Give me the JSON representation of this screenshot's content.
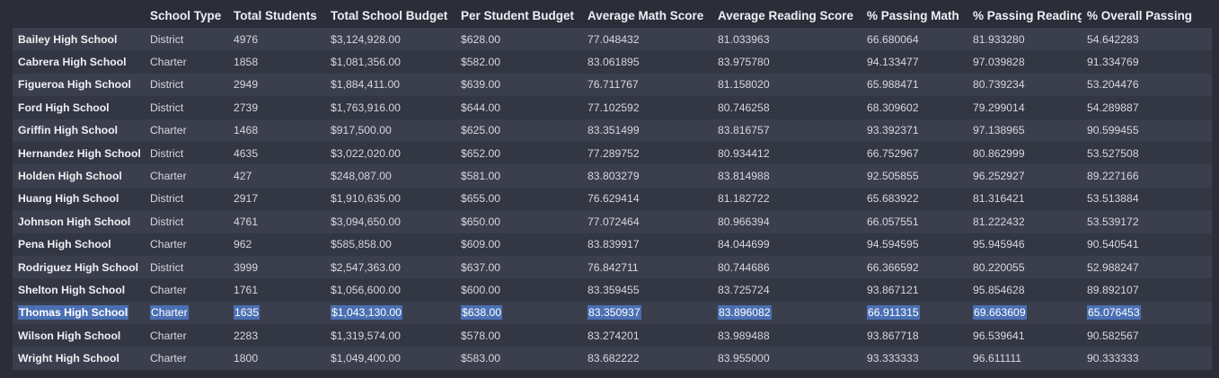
{
  "table": {
    "index_header": "",
    "columns": [
      "School Type",
      "Total Students",
      "Total School Budget",
      "Per Student Budget",
      "Average Math Score",
      "Average Reading Score",
      "% Passing Math",
      "% Passing Reading",
      "% Overall Passing"
    ],
    "rows": [
      {
        "name": "Bailey High School",
        "cells": [
          "District",
          "4976",
          "$3,124,928.00",
          "$628.00",
          "77.048432",
          "81.033963",
          "66.680064",
          "81.933280",
          "54.642283"
        ]
      },
      {
        "name": "Cabrera High School",
        "cells": [
          "Charter",
          "1858",
          "$1,081,356.00",
          "$582.00",
          "83.061895",
          "83.975780",
          "94.133477",
          "97.039828",
          "91.334769"
        ]
      },
      {
        "name": "Figueroa High School",
        "cells": [
          "District",
          "2949",
          "$1,884,411.00",
          "$639.00",
          "76.711767",
          "81.158020",
          "65.988471",
          "80.739234",
          "53.204476"
        ]
      },
      {
        "name": "Ford High School",
        "cells": [
          "District",
          "2739",
          "$1,763,916.00",
          "$644.00",
          "77.102592",
          "80.746258",
          "68.309602",
          "79.299014",
          "54.289887"
        ]
      },
      {
        "name": "Griffin High School",
        "cells": [
          "Charter",
          "1468",
          "$917,500.00",
          "$625.00",
          "83.351499",
          "83.816757",
          "93.392371",
          "97.138965",
          "90.599455"
        ]
      },
      {
        "name": "Hernandez High School",
        "cells": [
          "District",
          "4635",
          "$3,022,020.00",
          "$652.00",
          "77.289752",
          "80.934412",
          "66.752967",
          "80.862999",
          "53.527508"
        ]
      },
      {
        "name": "Holden High School",
        "cells": [
          "Charter",
          "427",
          "$248,087.00",
          "$581.00",
          "83.803279",
          "83.814988",
          "92.505855",
          "96.252927",
          "89.227166"
        ]
      },
      {
        "name": "Huang High School",
        "cells": [
          "District",
          "2917",
          "$1,910,635.00",
          "$655.00",
          "76.629414",
          "81.182722",
          "65.683922",
          "81.316421",
          "53.513884"
        ]
      },
      {
        "name": "Johnson High School",
        "cells": [
          "District",
          "4761",
          "$3,094,650.00",
          "$650.00",
          "77.072464",
          "80.966394",
          "66.057551",
          "81.222432",
          "53.539172"
        ]
      },
      {
        "name": "Pena High School",
        "cells": [
          "Charter",
          "962",
          "$585,858.00",
          "$609.00",
          "83.839917",
          "84.044699",
          "94.594595",
          "95.945946",
          "90.540541"
        ]
      },
      {
        "name": "Rodriguez High School",
        "cells": [
          "District",
          "3999",
          "$2,547,363.00",
          "$637.00",
          "76.842711",
          "80.744686",
          "66.366592",
          "80.220055",
          "52.988247"
        ]
      },
      {
        "name": "Shelton High School",
        "cells": [
          "Charter",
          "1761",
          "$1,056,600.00",
          "$600.00",
          "83.359455",
          "83.725724",
          "93.867121",
          "95.854628",
          "89.892107"
        ]
      },
      {
        "name": "Thomas High School",
        "cells": [
          "Charter",
          "1635",
          "$1,043,130.00",
          "$638.00",
          "83.350937",
          "83.896082",
          "66.911315",
          "69.663609",
          "65.076453"
        ],
        "selected": true
      },
      {
        "name": "Wilson High School",
        "cells": [
          "Charter",
          "2283",
          "$1,319,574.00",
          "$578.00",
          "83.274201",
          "83.989488",
          "93.867718",
          "96.539641",
          "90.582567"
        ]
      },
      {
        "name": "Wright High School",
        "cells": [
          "Charter",
          "1800",
          "$1,049,400.00",
          "$583.00",
          "83.682222",
          "83.955000",
          "93.333333",
          "96.611111",
          "90.333333"
        ]
      }
    ]
  },
  "colors": {
    "background": "#2b2e38",
    "row_odd": "#3b3f4d",
    "row_even": "#333744",
    "selection": "#4a6fb3"
  }
}
